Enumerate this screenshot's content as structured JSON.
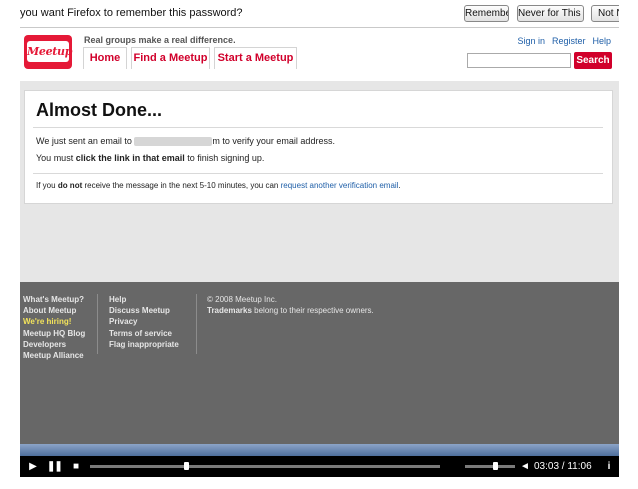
{
  "password_bar": {
    "message": "you want Firefox to remember this password?",
    "remember_label": "Remember",
    "never_label": "Never for This Site",
    "not_now_label": "Not No"
  },
  "header": {
    "logo_text": "Meetup",
    "tagline": "Real groups make a real difference.",
    "nav": [
      "Home",
      "Find a Meetup",
      "Start a Meetup"
    ],
    "links": [
      "Sign in",
      "Register",
      "Help"
    ],
    "search_placeholder": "",
    "search_button": "Search",
    "accent_color": "#d1002b"
  },
  "main": {
    "title": "Almost Done...",
    "line1_before": "We just sent an email to",
    "line1_after": "m to verify your email address.",
    "line2_before": "You must",
    "line2_bold": "click the link in that email",
    "line2_after": "to finish signing up.",
    "note_before": "If you",
    "note_bold": "do not",
    "note_middle": "receive the message in the next 5-10 minutes, you can",
    "note_link": "request another verification email",
    "note_end": "."
  },
  "footer": {
    "col1": [
      "What's Meetup?",
      "About Meetup",
      "We're hiring!",
      "Meetup HQ Blog",
      "Developers",
      "Meetup Alliance"
    ],
    "col2": [
      "Help",
      "Discuss Meetup",
      "Privacy",
      "Terms of service",
      "Flag inappropriate"
    ],
    "copyright": "© 2008 Meetup Inc.",
    "trademark_bold": "Trademarks",
    "trademark_rest": "belong to their respective owners."
  },
  "player": {
    "time": "03:03 / 11:06",
    "progress_fraction": 0.275,
    "volume_fraction": 0.6
  }
}
